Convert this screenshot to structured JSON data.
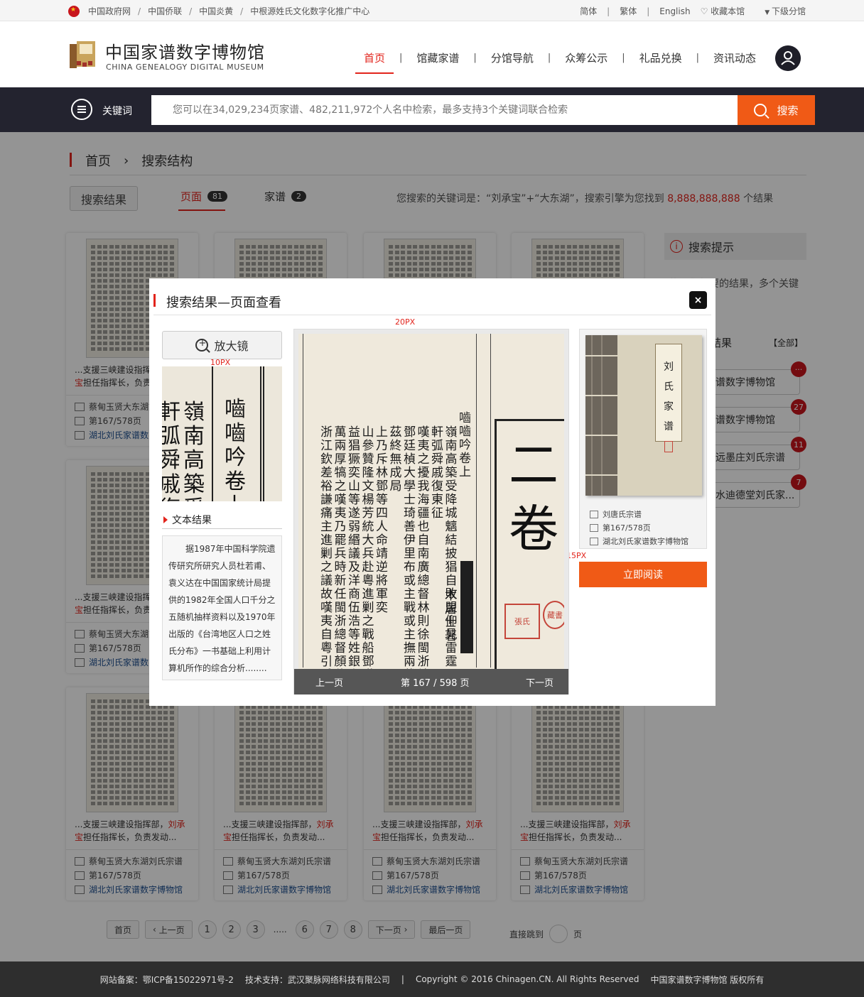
{
  "topbar": {
    "links": [
      "中国政府网",
      "中国侨联",
      "中国炎黄",
      "中根源姓氏文化数字化推广中心"
    ],
    "lang_simplified": "简体",
    "lang_traditional": "繁体",
    "lang_english": "English",
    "favorite": "收藏本馆",
    "sub_branch": "下级分馆"
  },
  "header": {
    "logo_cn": "中国家谱数字博物馆",
    "logo_en": "CHINA GENEALOGY DIGITAL MUSEUM",
    "nav": [
      "首页",
      "馆藏家谱",
      "分馆导航",
      "众筹公示",
      "礼品兑换",
      "资讯动态"
    ]
  },
  "search": {
    "keyword_label": "关键词",
    "placeholder": "您可以在34,029,234页家谱、482,211,972个人名中检索，最多支持3个关键词联合检索",
    "button": "搜索"
  },
  "breadcrumb": {
    "home": "首页",
    "current": "搜索结构"
  },
  "results": {
    "button": "搜索结果",
    "tab_page": "页面",
    "tab_page_count": "81",
    "tab_genealogy": "家谱",
    "tab_genealogy_count": "2",
    "summary_prefix": "您搜索的关键词是：“刘承宝”+“大东湖”，搜索引擎为您找到",
    "summary_count": "8,888,888,888",
    "summary_suffix": "个结果"
  },
  "card": {
    "snippet_a": "...支援三峡建设指挥部，",
    "snippet_hl": "刘承宝",
    "snippet_b": "担任指挥长，负责发动...",
    "clan": "蔡甸玉贤大东湖刘氏宗谱",
    "pages": "第167/578页",
    "museum": "湖北刘氏家谱数字博物馆"
  },
  "sidebar": {
    "title": "搜索提示",
    "tip": "找到您想要的结果，多个关键词组合",
    "sub_title": "结果",
    "all_label": "【全部】",
    "items": [
      {
        "label": "谱数字博物馆",
        "badge": "···"
      },
      {
        "label": "谱数字博物馆",
        "badge": "27"
      },
      {
        "label": "远墨庄刘氏宗谱",
        "badge": "11"
      },
      {
        "label": "水迪德堂刘氏家...",
        "badge": "7"
      }
    ]
  },
  "pager": {
    "first": "首页",
    "prev": "上一页",
    "pages": [
      "1",
      "2",
      "3",
      "6",
      "7",
      "8"
    ],
    "dots": ".....",
    "next": "下一页",
    "last": "最后一页",
    "jump_label": "直接跳到",
    "jump_unit": "页"
  },
  "footer": {
    "icp": "网站备案：鄂ICP备15022971号-2",
    "tech": "技术支持：武汉聚脉网络科技有限公司",
    "sep": "|",
    "copyright": "Copyright © 2016  Chinagen.CN. All Rights Reserved",
    "owner": "中国家谱数字博物馆 版权所有"
  },
  "modal": {
    "title": "搜索结果—页面查看",
    "close": "×",
    "magnify_button": "放大镜",
    "spacing_20": "20PX",
    "spacing_10": "10PX",
    "spacing_15": "15PX",
    "text_result_title": "文本结果",
    "text_result": "据1987年中国科学院遗传研究所研究人员杜若甫、袁义达在中国国家统计局提供的1982年全国人口千分之五随机抽样资料以及1970年出版的《台湾地区人口之姓氏分布》一书基础上利用计算机所作的综合分析........",
    "viewer_prev": "上一页",
    "viewer_info": "第 167 / 598 页",
    "viewer_next": "下一页",
    "book_title": "刘氏家谱",
    "book_clan": "刘唐氏宗谱",
    "book_pages": "第167/578页",
    "book_museum": "湖北刘氏家谱数字博物馆",
    "read_button": "立即阅读"
  },
  "scan": {
    "zoom_cols": [
      "嚙嚙吟卷上",
      "嶺南高築受降",
      "軒弧舜戚復東"
    ],
    "page_cols": [
      "嚙嚙吟卷上",
      "嶺南高築受降城魑結披猖自敗盟仰見雷霆天怒赫",
      "軒弧舜戚復東征",
      "嘆夷之擾我海疆也自南廣總督林則徐閩浙總督",
      "鄧廷楨大學士琦善伊里布或主戰或主撫兩載於",
      "茲終無成局",
      "上乃斥林鄧等四人命靖逆將軍奕",
      "山參贊隆文楊芳統大兵赴粵進剿之戰船鄧嘆夷",
      "益猖獗奕山等遂弱緡議及洋商伍浩等姓銀六百",
      "萬兩厚犒之嘆夷乃罷兵時新任閩浙總督顏伯燾",
      "浙江欽差裕謙痛主進剿之議故嘆夷自粵引兵向"
    ],
    "page_author": "木居士著",
    "page_big": "二卷",
    "seal_a": "張氏",
    "seal_b": "藏書"
  }
}
